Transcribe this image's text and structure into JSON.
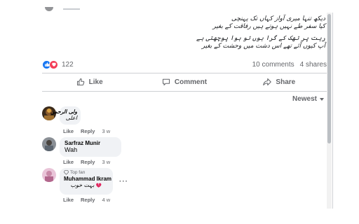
{
  "post": {
    "poem_lines": [
      "دیکھ تنہا میری آواز کہاں تک پہنچی",
      "کیا سفر طے نہیں ہوتے ہیں رفاقت کے بغیر",
      "ریت پر تھک کے گرا ہوں تو ہوا پوچھتی ہے",
      "آپ کیوں آئے تھے اس دشت میں وحشت کے بغیر"
    ],
    "reaction_count": "122",
    "comments_count": "10 comments",
    "shares_count": "4 shares"
  },
  "actions": {
    "like": "Like",
    "comment": "Comment",
    "share": "Share"
  },
  "sort_label": "Newest",
  "comments": [
    {
      "name": "ولی الرحمن",
      "text": "اعلی",
      "like": "Like",
      "reply": "Reply",
      "time": "3 w"
    },
    {
      "name": "Sarfraz Munir",
      "text": "Wah",
      "like": "Like",
      "reply": "Reply",
      "time": "3 w"
    },
    {
      "badge": "Top fan",
      "name": "Muhammad Ikram",
      "text": "بہت خوب",
      "like": "Like",
      "reply": "Reply",
      "time": "4 w"
    }
  ],
  "icons": {
    "like_reaction": "like-reaction-icon",
    "love_reaction": "love-reaction-icon",
    "like_action": "thumbs-up-icon",
    "comment_action": "speech-bubble-icon",
    "share_action": "share-arrow-icon",
    "top_fan": "diamond-icon",
    "heart_emoji": "broken-heart-emoji"
  },
  "colors": {
    "accent_blue": "#1877f2",
    "love_red": "#f33e58",
    "secondary_text": "#65676b",
    "bubble_bg": "#f0f2f5"
  }
}
